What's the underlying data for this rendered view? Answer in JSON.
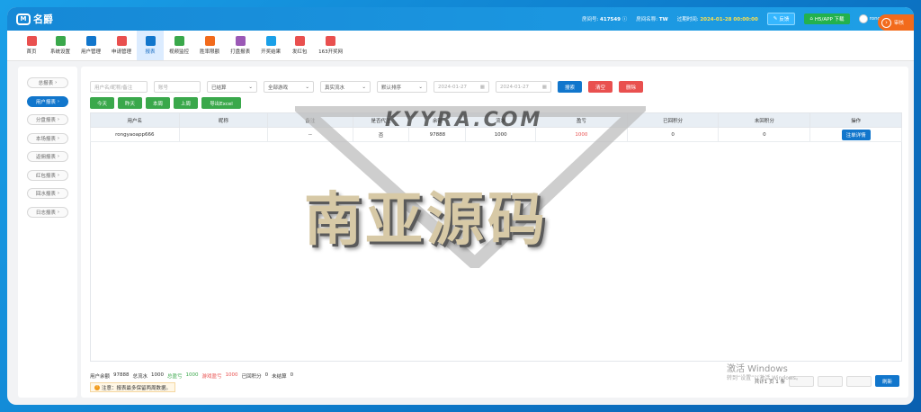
{
  "header": {
    "logo_text": "名爵",
    "logo_mark": "M",
    "room_no_label": "房间号:",
    "room_no": "417549",
    "room_name_label": "房间名称:",
    "room_name": "TW",
    "expire_label": "过期时间:",
    "expire_time": "2024-01-28 00:00:00",
    "trial_button": "反馈",
    "app_download": "H5/APP 下载",
    "user_name": "rongyaoapp"
  },
  "nav": [
    {
      "label": "首页",
      "color": "#e9504f"
    },
    {
      "label": "系统设置",
      "color": "#3aa84b"
    },
    {
      "label": "用户管理",
      "color": "#1176cc"
    },
    {
      "label": "申请管理",
      "color": "#e9504f"
    },
    {
      "label": "报表",
      "color": "#1176cc"
    },
    {
      "label": "视频监控",
      "color": "#3aa84b"
    },
    {
      "label": "胜率限额",
      "color": "#f26b1c"
    },
    {
      "label": "打盘报表",
      "color": "#9b59b6"
    },
    {
      "label": "开奖结果",
      "color": "#1aa0e8"
    },
    {
      "label": "发红包",
      "color": "#e9504f"
    },
    {
      "label": "163开奖网",
      "color": "#e9504f"
    }
  ],
  "audit_button": "审核",
  "sidebar": [
    {
      "label": "总报表"
    },
    {
      "label": "用户报表"
    },
    {
      "label": "分盘报表"
    },
    {
      "label": "本场报表"
    },
    {
      "label": "返佣报表"
    },
    {
      "label": "红包报表"
    },
    {
      "label": "回水报表"
    },
    {
      "label": "日志报表"
    }
  ],
  "filters": {
    "username_placeholder": "用户名/昵称/备注",
    "account_placeholder": "账号",
    "status_select": "已结算",
    "game_select": "全部游戏",
    "flow_select": "真实流水",
    "sort_select": "默认排序",
    "date_start": "2024-01-27",
    "date_end": "2024-01-27",
    "search": "搜索",
    "clear": "清空",
    "delete": "删除"
  },
  "quick_buttons": [
    "今天",
    "昨天",
    "本周",
    "上周",
    "导出Excel"
  ],
  "table": {
    "headers": [
      "用户名",
      "昵称",
      "备注",
      "是否代注",
      "余额",
      "流水",
      "盈亏",
      "已回积分",
      "未回积分",
      "操作"
    ],
    "rows": [
      {
        "username": "rongyaoapp666",
        "nickname": "",
        "remark": "--",
        "proxy": "否",
        "balance": "97888",
        "flow": "1000",
        "profit": "1000",
        "returned": "0",
        "unreturned": "0",
        "action": "注单详情"
      }
    ]
  },
  "summary": {
    "balance_label": "用户余额",
    "balance": "97888",
    "flow_label": "总流水",
    "flow": "1000",
    "profit_label": "总盈亏",
    "profit": "1000",
    "game_profit_label": "游戏盈亏",
    "game_profit": "1000",
    "returned_label": "已回积分",
    "returned": "0",
    "unsettled_label": "未结算",
    "unsettled": "0"
  },
  "notice": "注意：报表最多保留两周数据。",
  "pager": {
    "summary": "共计1 页 1 条",
    "refresh": "刷新"
  },
  "watermark": {
    "url": "KYYRA.COM",
    "title": "南亚源码"
  },
  "windows": {
    "title": "激活 Windows",
    "sub": "转到“设置”以激活 Windows。"
  }
}
